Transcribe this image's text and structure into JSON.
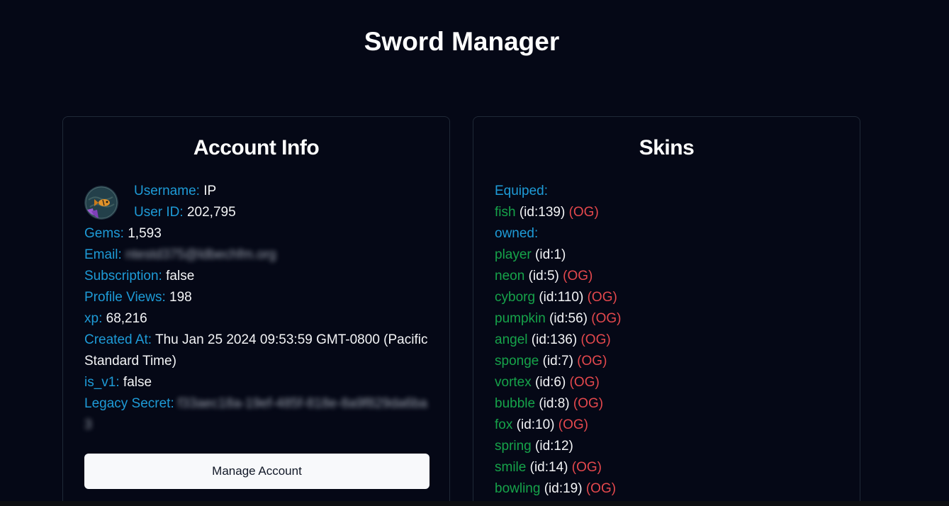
{
  "page_title": "Sword Manager",
  "account": {
    "title": "Account Info",
    "username_label": "Username:",
    "username": "IP",
    "userid_label": "User ID:",
    "userid": "202,795",
    "gems_label": "Gems:",
    "gems": "1,593",
    "email_label": "Email:",
    "email": "ntestd375@ldbechfm.org",
    "subscription_label": "Subscription:",
    "subscription": "false",
    "profile_views_label": "Profile Views:",
    "profile_views": "198",
    "xp_label": "xp:",
    "xp": "68,216",
    "created_label": "Created At:",
    "created": "Thu Jan 25 2024 09:53:59 GMT-0800 (Pacific Standard Time)",
    "is_v1_label": "is_v1:",
    "is_v1": "false",
    "legacy_label": "Legacy Secret:",
    "legacy": "f33aec18a-19ef-485f-818e-8a9f829da6ba3",
    "manage_button": "Manage Account"
  },
  "skins": {
    "title": "Skins",
    "equipped_label": "Equiped:",
    "equipped": {
      "name": "fish",
      "id": "(id:139)",
      "og": "(OG)"
    },
    "owned_label": "owned:",
    "owned": [
      {
        "name": "player",
        "id": "(id:1)",
        "og": ""
      },
      {
        "name": "neon",
        "id": "(id:5)",
        "og": "(OG)"
      },
      {
        "name": "cyborg",
        "id": "(id:110)",
        "og": "(OG)"
      },
      {
        "name": "pumpkin",
        "id": "(id:56)",
        "og": "(OG)"
      },
      {
        "name": "angel",
        "id": "(id:136)",
        "og": "(OG)"
      },
      {
        "name": "sponge",
        "id": "(id:7)",
        "og": "(OG)"
      },
      {
        "name": "vortex",
        "id": "(id:6)",
        "og": "(OG)"
      },
      {
        "name": "bubble",
        "id": "(id:8)",
        "og": "(OG)"
      },
      {
        "name": "fox",
        "id": "(id:10)",
        "og": "(OG)"
      },
      {
        "name": "spring",
        "id": "(id:12)",
        "og": ""
      },
      {
        "name": "smile",
        "id": "(id:14)",
        "og": "(OG)"
      },
      {
        "name": "bowling",
        "id": "(id:19)",
        "og": "(OG)"
      }
    ]
  },
  "colors": {
    "background": "#050816",
    "label": "#1e9bd7",
    "skin_name": "#16a34a",
    "og_tag": "#e5484d",
    "button_bg": "#f8f9fb"
  },
  "icons": {
    "avatar": "fish-avatar"
  }
}
